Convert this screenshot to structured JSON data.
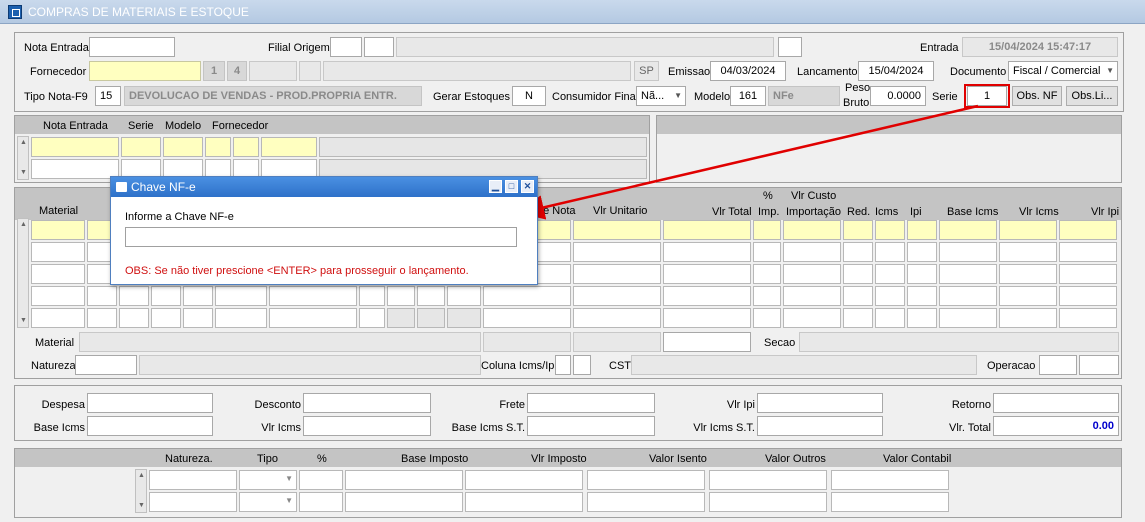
{
  "window": {
    "title": "COMPRAS DE MATERIAIS E ESTOQUE"
  },
  "header": {
    "nota_entrada_label": "Nota Entrada",
    "filial_origem_label": "Filial Origem",
    "entrada_label": "Entrada",
    "entrada_value": "15/04/2024 15:47:17",
    "fornecedor_label": "Fornecedor",
    "fornecedor_code1": "1",
    "fornecedor_code2": "4",
    "uf_value": "SP",
    "emissao_label": "Emissao",
    "emissao_value": "04/03/2024",
    "lancamento_label": "Lancamento",
    "lancamento_value": "15/04/2024",
    "documento_label": "Documento",
    "documento_value": "Fiscal / Comercial",
    "tipo_nota_label": "Tipo Nota-F9",
    "tipo_nota_code": "15",
    "tipo_nota_desc": "DEVOLUCAO DE VENDAS - PROD.PROPRIA ENTR.",
    "gerar_estoques_label": "Gerar Estoques",
    "gerar_estoques_value": "N",
    "consumidor_final_label": "Consumidor Final",
    "consumidor_final_value": "Nã...",
    "modelo_label": "Modelo",
    "modelo_value": "161",
    "modelo_desc": "NFe",
    "peso_label_1": "Peso",
    "peso_label_2": "Bruto",
    "peso_value": "0.0000",
    "serie_label": "Serie",
    "serie_value": "1",
    "obs_nf_button": "Obs. NF",
    "obs_li_button": "Obs.Li..."
  },
  "notes_grid": {
    "columns": [
      "Nota Entrada",
      "Serie",
      "Modelo",
      "Fornecedor"
    ]
  },
  "items_grid": {
    "columns": {
      "material": "Material",
      "nota": "de Nota",
      "vlr_unitario": "Vlr Unitario",
      "vlr_total": "Vlr Total",
      "pct_imp_1": "%",
      "pct_imp_2": "Imp.",
      "custo_1": "Vlr Custo",
      "custo_2": "Importação",
      "red": "Red.",
      "icms": "Icms",
      "ipi": "Ipi",
      "base_icms": "Base Icms",
      "vlr_icms": "Vlr Icms",
      "vlr_ipi": "Vlr Ipi"
    },
    "material_label": "Material",
    "secao_label": "Secao",
    "natureza_label": "Natureza",
    "coluna_icms_ipi_label": "Coluna Icms/Ipi",
    "cst_label": "CST",
    "operacao_label": "Operacao"
  },
  "totals": {
    "despesa_label": "Despesa",
    "desconto_label": "Desconto",
    "frete_label": "Frete",
    "vlr_ipi_label": "Vlr Ipi",
    "retorno_label": "Retorno",
    "base_icms_label": "Base Icms",
    "vlr_icms_label": "Vlr Icms",
    "base_icms_st_label": "Base Icms S.T.",
    "vlr_icms_st_label": "Vlr Icms S.T.",
    "vlr_total_label": "Vlr. Total",
    "vlr_total_value": "0.00"
  },
  "tax_grid": {
    "columns": [
      "Natureza.",
      "Tipo",
      "%",
      "Base Imposto",
      "Vlr Imposto",
      "Valor Isento",
      "Valor Outros",
      "Valor Contabil"
    ]
  },
  "dialog": {
    "title": "Chave NF-e",
    "prompt": "Informe a Chave NF-e",
    "input_value": "",
    "obs": "OBS: Se não tiver prescione <ENTER> para prosseguir o lançamento."
  },
  "colors": {
    "accent": "#2e71c9",
    "highlight": "#e00000",
    "required": "#ffffc0",
    "total": "#0000cc"
  }
}
